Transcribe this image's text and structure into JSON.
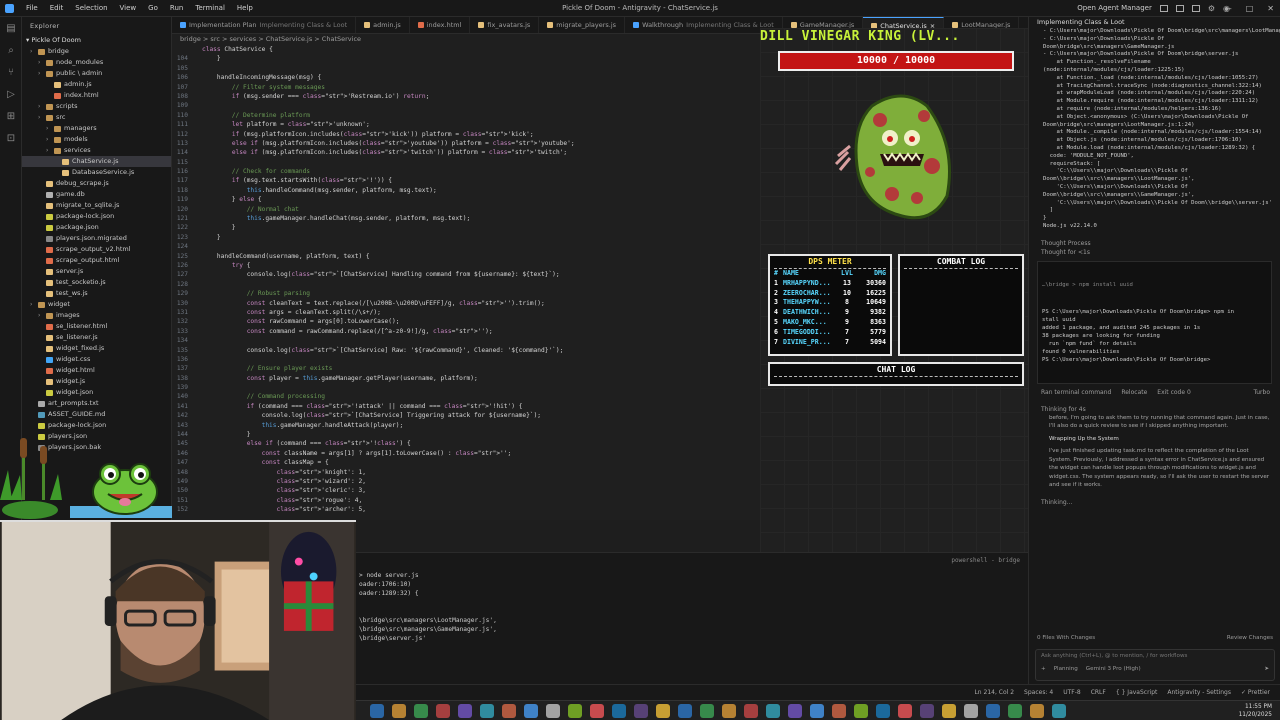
{
  "titlebar": {
    "menu": [
      "File",
      "Edit",
      "Selection",
      "View",
      "Go",
      "Run",
      "Terminal",
      "Help"
    ],
    "title": "Pickle Of Doom - Antigravity - ChatService.js",
    "agent_manager": "Open Agent Manager"
  },
  "explorer": {
    "header": "Explorer",
    "root": "Pickle Of Doom",
    "items": [
      {
        "label": "bridge",
        "depth": 1,
        "type": "folder"
      },
      {
        "label": "node_modules",
        "depth": 2,
        "type": "folder"
      },
      {
        "label": "public \\ admin",
        "depth": 2,
        "type": "folder"
      },
      {
        "label": "admin.js",
        "depth": 3,
        "type": "js"
      },
      {
        "label": "index.html",
        "depth": 3,
        "type": "html"
      },
      {
        "label": "scripts",
        "depth": 2,
        "type": "folder"
      },
      {
        "label": "src",
        "depth": 2,
        "type": "folder"
      },
      {
        "label": "managers",
        "depth": 3,
        "type": "folder"
      },
      {
        "label": "models",
        "depth": 3,
        "type": "folder"
      },
      {
        "label": "services",
        "depth": 3,
        "type": "folder"
      },
      {
        "label": "ChatService.js",
        "depth": 4,
        "type": "js",
        "selected": true
      },
      {
        "label": "DatabaseService.js",
        "depth": 4,
        "type": "js"
      },
      {
        "label": "debug_scrape.js",
        "depth": 2,
        "type": "js"
      },
      {
        "label": "game.db",
        "depth": 2,
        "type": "db"
      },
      {
        "label": "migrate_to_sqlite.js",
        "depth": 2,
        "type": "js"
      },
      {
        "label": "package-lock.json",
        "depth": 2,
        "type": "json"
      },
      {
        "label": "package.json",
        "depth": 2,
        "type": "json"
      },
      {
        "label": "players.json.migrated",
        "depth": 2,
        "type": "file"
      },
      {
        "label": "scrape_output_v2.html",
        "depth": 2,
        "type": "html"
      },
      {
        "label": "scrape_output.html",
        "depth": 2,
        "type": "html"
      },
      {
        "label": "server.js",
        "depth": 2,
        "type": "js"
      },
      {
        "label": "test_socketio.js",
        "depth": 2,
        "type": "js"
      },
      {
        "label": "test_ws.js",
        "depth": 2,
        "type": "js"
      },
      {
        "label": "widget",
        "depth": 1,
        "type": "folder"
      },
      {
        "label": "images",
        "depth": 2,
        "type": "folder"
      },
      {
        "label": "se_listener.html",
        "depth": 2,
        "type": "html"
      },
      {
        "label": "se_listener.js",
        "depth": 2,
        "type": "js"
      },
      {
        "label": "widget_fixed.js",
        "depth": 2,
        "type": "js"
      },
      {
        "label": "widget.css",
        "depth": 2,
        "type": "css"
      },
      {
        "label": "widget.html",
        "depth": 2,
        "type": "html"
      },
      {
        "label": "widget.js",
        "depth": 2,
        "type": "js"
      },
      {
        "label": "widget.json",
        "depth": 2,
        "type": "json"
      },
      {
        "label": "art_prompts.txt",
        "depth": 1,
        "type": "txt"
      },
      {
        "label": "ASSET_GUIDE.md",
        "depth": 1,
        "type": "md"
      },
      {
        "label": "package-lock.json",
        "depth": 1,
        "type": "json"
      },
      {
        "label": "players.json",
        "depth": 1,
        "type": "json"
      },
      {
        "label": "players.json.bak",
        "depth": 1,
        "type": "file"
      }
    ]
  },
  "tabs": [
    {
      "label": "Implementation Plan",
      "dim": "Implementing Class & Loot",
      "color": "#4aa3ff"
    },
    {
      "label": "admin.js",
      "dim": "",
      "color": "#e5c07b"
    },
    {
      "label": "index.html",
      "dim": "",
      "color": "#e06c4a"
    },
    {
      "label": "fix_avatars.js",
      "dim": "",
      "color": "#e5c07b"
    },
    {
      "label": "migrate_players.js",
      "dim": "",
      "color": "#e5c07b"
    },
    {
      "label": "Walkthrough",
      "dim": "Implementing Class & Loot",
      "color": "#4aa3ff"
    },
    {
      "label": "GameManager.js",
      "dim": "",
      "color": "#e5c07b"
    },
    {
      "label": "ChatService.js",
      "dim": "",
      "color": "#e5c07b",
      "active": true
    },
    {
      "label": "LootManager.js",
      "dim": "",
      "color": "#e5c07b"
    }
  ],
  "breadcrumb": "bridge > src > services > ChatService.js > ChatService",
  "code": [
    {
      "n": "",
      "t": "class ChatService {"
    },
    {
      "n": "104",
      "t": "    }"
    },
    {
      "n": "105",
      "t": ""
    },
    {
      "n": "106",
      "t": "    handleIncomingMessage(msg) {"
    },
    {
      "n": "107",
      "t": "        // Filter system messages"
    },
    {
      "n": "108",
      "t": "        if (msg.sender === 'Restream.io') return;"
    },
    {
      "n": "109",
      "t": ""
    },
    {
      "n": "110",
      "t": "        // Determine platform"
    },
    {
      "n": "111",
      "t": "        let platform = 'unknown';"
    },
    {
      "n": "112",
      "t": "        if (msg.platformIcon.includes('kick')) platform = 'kick';"
    },
    {
      "n": "113",
      "t": "        else if (msg.platformIcon.includes('youtube')) platform = 'youtube';"
    },
    {
      "n": "114",
      "t": "        else if (msg.platformIcon.includes('twitch')) platform = 'twitch';"
    },
    {
      "n": "115",
      "t": ""
    },
    {
      "n": "116",
      "t": "        // Check for commands"
    },
    {
      "n": "117",
      "t": "        if (msg.text.startsWith('!')) {"
    },
    {
      "n": "118",
      "t": "            this.handleCommand(msg.sender, platform, msg.text);"
    },
    {
      "n": "119",
      "t": "        } else {"
    },
    {
      "n": "120",
      "t": "            // Normal chat"
    },
    {
      "n": "121",
      "t": "            this.gameManager.handleChat(msg.sender, platform, msg.text);"
    },
    {
      "n": "122",
      "t": "        }"
    },
    {
      "n": "123",
      "t": "    }"
    },
    {
      "n": "124",
      "t": ""
    },
    {
      "n": "125",
      "t": "    handleCommand(username, platform, text) {"
    },
    {
      "n": "126",
      "t": "        try {"
    },
    {
      "n": "127",
      "t": "            console.log(`[ChatService] Handling command from ${username}: ${text}`);"
    },
    {
      "n": "128",
      "t": ""
    },
    {
      "n": "129",
      "t": "            // Robust parsing"
    },
    {
      "n": "130",
      "t": "            const cleanText = text.replace(/[\\u200B-\\u200D\\uFEFF]/g, '').trim();"
    },
    {
      "n": "131",
      "t": "            const args = cleanText.split(/\\s+/);"
    },
    {
      "n": "132",
      "t": "            const rawCommand = args[0].toLowerCase();"
    },
    {
      "n": "133",
      "t": "            const command = rawCommand.replace(/[^a-z0-9!]/g, '');"
    },
    {
      "n": "134",
      "t": ""
    },
    {
      "n": "135",
      "t": "            console.log(`[ChatService] Raw: '${rawCommand}', Cleaned: '${command}'`);"
    },
    {
      "n": "136",
      "t": ""
    },
    {
      "n": "137",
      "t": "            // Ensure player exists"
    },
    {
      "n": "138",
      "t": "            const player = this.gameManager.getPlayer(username, platform);"
    },
    {
      "n": "139",
      "t": ""
    },
    {
      "n": "140",
      "t": "            // Command processing"
    },
    {
      "n": "141",
      "t": "            if (command === '!attack' || command === '!hit') {"
    },
    {
      "n": "142",
      "t": "                console.log(`[ChatService] Triggering attack for ${username}`);"
    },
    {
      "n": "143",
      "t": "                this.gameManager.handleAttack(player);"
    },
    {
      "n": "144",
      "t": "            }"
    },
    {
      "n": "145",
      "t": "            else if (command === '!class') {"
    },
    {
      "n": "146",
      "t": "                const className = args[1] ? args[1].toLowerCase() : '';"
    },
    {
      "n": "147",
      "t": "                const classMap = {"
    },
    {
      "n": "148",
      "t": "                    'knight': 1,"
    },
    {
      "n": "149",
      "t": "                    'wizard': 2,"
    },
    {
      "n": "150",
      "t": "                    'cleric': 3,"
    },
    {
      "n": "151",
      "t": "                    'rogue': 4,"
    },
    {
      "n": "152",
      "t": "                    'archer': 5,"
    }
  ],
  "terminal": {
    "header": "powershell - bridge",
    "lines": [
      "> node server.js",
      "oader:1706:10)",
      "oader:1289:32) {",
      "",
      "",
      "\\bridge\\src\\managers\\LootManager.js',",
      "\\bridge\\src\\managers\\GameManager.js',",
      "\\bridge\\server.js'",
      "",
      "",
      "",
      "",
      "",
      "> "
    ]
  },
  "game": {
    "boss_name": "DILL VINEGAR KING (LV...",
    "hp_text": "10000 / 10000",
    "hp_fraction": 1.0,
    "dps_title": "DPS METER",
    "dps_headers": {
      "rank": "#",
      "name": "NAME",
      "lvl": "LVL",
      "dmg": "DMG"
    },
    "dps_rows": [
      {
        "rank": "1",
        "name": "MRHAPPYND...",
        "lvl": "13",
        "dmg": "30360"
      },
      {
        "rank": "2",
        "name": "ZEEROCHAR...",
        "lvl": "10",
        "dmg": "16225"
      },
      {
        "rank": "3",
        "name": "THEHAPPYW...",
        "lvl": "8",
        "dmg": "10649"
      },
      {
        "rank": "4",
        "name": "DEATHWICH...",
        "lvl": "9",
        "dmg": "9382"
      },
      {
        "rank": "5",
        "name": "MAKO_MKC...",
        "lvl": "9",
        "dmg": "8363"
      },
      {
        "rank": "6",
        "name": "TIMEGODDI...",
        "lvl": "7",
        "dmg": "5779"
      },
      {
        "rank": "7",
        "name": "DIVINE_PR...",
        "lvl": "7",
        "dmg": "5094"
      }
    ],
    "combat_title": "COMBAT LOG",
    "chat_title": "CHAT LOG"
  },
  "agent": {
    "header": "Implementing Class & Loot",
    "error_lines": [
      "- C:\\Users\\major\\Downloads\\Pickle Of Doom\\bridge\\src\\managers\\LootManager.js",
      "- C:\\Users\\major\\Downloads\\Pickle Of",
      "Doom\\bridge\\src\\managers\\GameManager.js",
      "- C:\\Users\\major\\Downloads\\Pickle Of Doom\\bridge\\server.js",
      "    at Function._resolveFilename",
      "(node:internal/modules/cjs/loader:1225:15)",
      "    at Function._load (node:internal/modules/cjs/loader:1055:27)",
      "    at TracingChannel.traceSync (node:diagnostics_channel:322:14)",
      "    at wrapModuleLoad (node:internal/modules/cjs/loader:220:24)",
      "    at Module.require (node:internal/modules/cjs/loader:1311:12)",
      "    at require (node:internal/modules/helpers:136:16)",
      "    at Object.<anonymous> (C:\\Users\\major\\Downloads\\Pickle Of",
      "Doom\\bridge\\src\\managers\\LootManager.js:1:24)",
      "    at Module._compile (node:internal/modules/cjs/loader:1554:14)",
      "    at Object.js (node:internal/modules/cjs/loader:1706:10)",
      "    at Module.load (node:internal/modules/cjs/loader:1289:32) {",
      "  code: 'MODULE_NOT_FOUND',",
      "  requireStack: [",
      "    'C:\\\\Users\\\\major\\\\Downloads\\\\Pickle Of",
      "Doom\\\\bridge\\\\src\\\\managers\\\\LootManager.js',",
      "    'C:\\\\Users\\\\major\\\\Downloads\\\\Pickle Of",
      "Doom\\\\bridge\\\\src\\\\managers\\\\GameManager.js',",
      "    'C:\\\\Users\\\\major\\\\Downloads\\\\Pickle Of Doom\\\\bridge\\\\server.js'",
      "  ]",
      "}",
      "",
      "Node.js v22.14.0"
    ],
    "thought1": "Thought Process",
    "thought2": "Thought for <1s",
    "term_cmd": "…\\bridge > npm install uuid",
    "term_lines": [
      "PS C:\\Users\\major\\Downloads\\Pickle Of Doom\\bridge> npm in",
      "stall uuid",
      "",
      "added 1 package, and audited 245 packages in 1s",
      "",
      "38 packages are looking for funding",
      "  run `npm fund` for details",
      "",
      "found 0 vulnerabilities",
      "PS C:\\Users\\major\\Downloads\\Pickle Of Doom\\bridge>"
    ],
    "ran_terminal": "Ran terminal command",
    "relocate": "Relocate",
    "exit_code": "Exit code 0",
    "turbo": "Turbo",
    "thinking_for": "Thinking for 4s",
    "para1": "before, I'm going to ask them to try running that command again. Just in case, I'll also do a quick review to see if I skipped anything important.",
    "wrap_title": "Wrapping Up the System",
    "para2": "I've just finished updating task.md to reflect the completion of the Loot System. Previously, I addressed a syntax error in ChatService.js and ensured the widget can handle loot popups through modifications to widget.js and widget.css. The system appears ready, so I'll ask the user to restart the server and see if it works.",
    "thinking": "Thinking...",
    "files_changed": "0 Files With Changes",
    "review": "Review Changes",
    "input_placeholder": "Ask anything (Ctrl+L), @ to mention, / for workflows",
    "planning": "Planning",
    "model": "Gemini 3 Pro (High)"
  },
  "statusbar": {
    "items": [
      "Ln 214, Col 2",
      "Spaces: 4",
      "UTF-8",
      "CRLF",
      "{ } JavaScript",
      "Antigravity - Settings",
      "✓ Prettier"
    ]
  },
  "taskbar": {
    "time": "11:55 PM",
    "date": "11/20/2025"
  },
  "colors": {
    "accent": "#4aa3ff",
    "boss_name": "#c8f23a",
    "hp_fill": "#c31414",
    "dps_title": "#ffe24a",
    "dps_name": "#58d8ff"
  }
}
